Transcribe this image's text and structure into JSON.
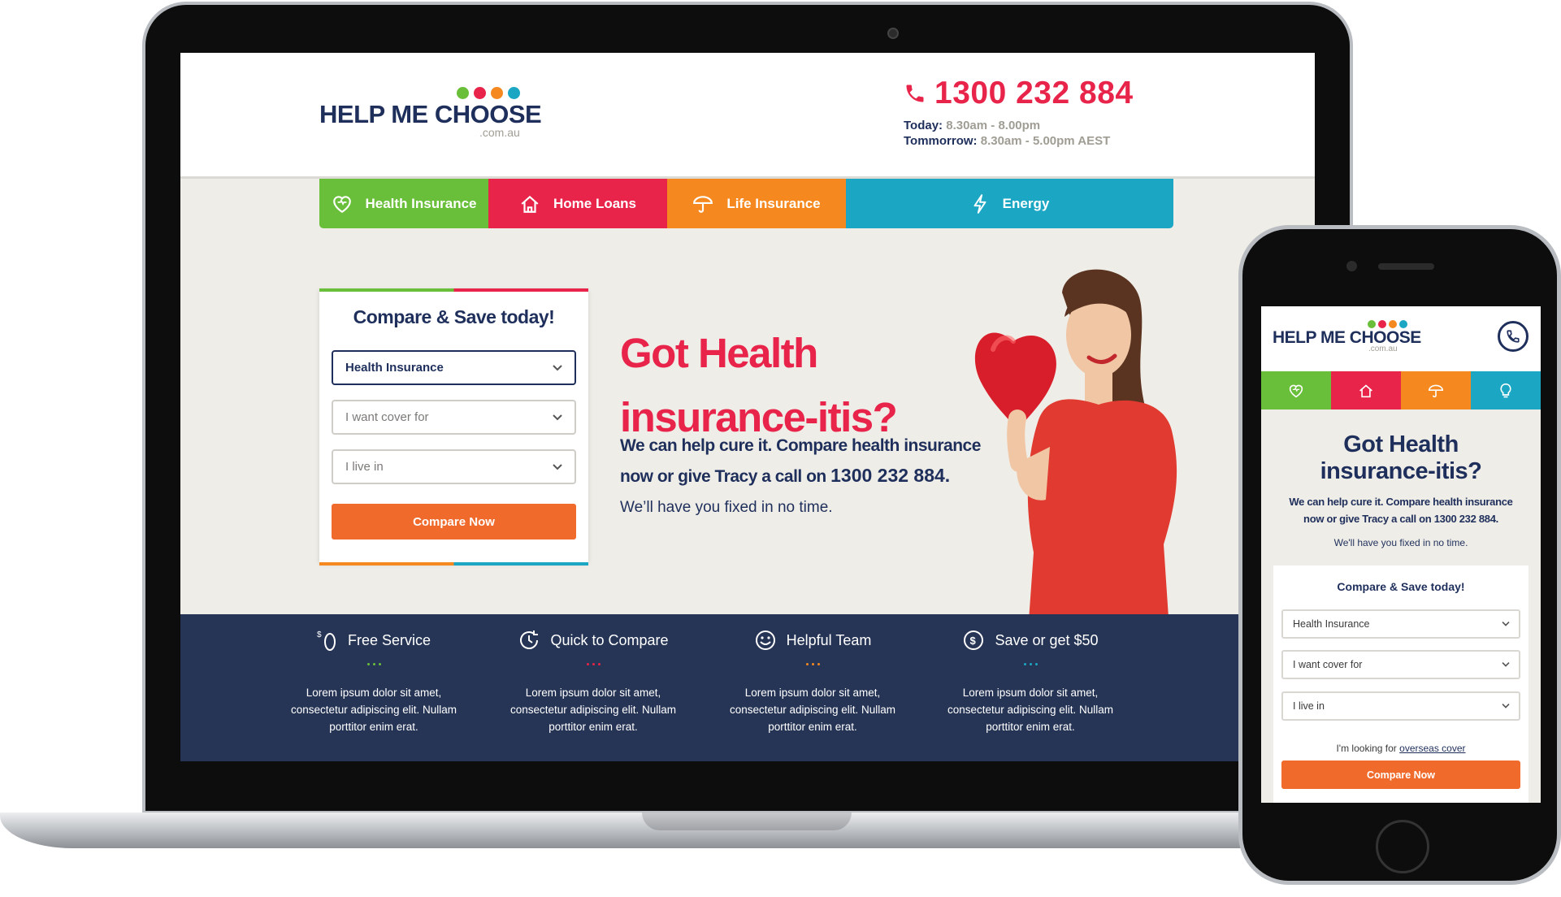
{
  "brand": {
    "name": "HELP ME CHOOSE",
    "domain": ".com.au",
    "dot_colors": [
      "#6abf3a",
      "#e8244a",
      "#f5891f",
      "#1ba7c4"
    ]
  },
  "header": {
    "phone": "1300 232 884",
    "today_label": "Today:",
    "today_hours": "8.30am - 8.00pm",
    "tomorrow_label": "Tommorrow:",
    "tomorrow_hours": "8.30am - 5.00pm AEST"
  },
  "nav": [
    {
      "label": "Health Insurance",
      "icon": "heart-icon",
      "color": "#6abf3a"
    },
    {
      "label": "Home Loans",
      "icon": "home-icon",
      "color": "#e8244a"
    },
    {
      "label": "Life Insurance",
      "icon": "umbrella-icon",
      "color": "#f5891f"
    },
    {
      "label": "Energy",
      "icon": "lightning-icon",
      "color": "#1ba7c4"
    }
  ],
  "form": {
    "title": "Compare & Save today!",
    "insurance_type": "Health Insurance",
    "cover_placeholder": "I want cover for",
    "location_placeholder": "I live in",
    "submit": "Compare Now"
  },
  "hero": {
    "line1": "Got Health",
    "line2": "insurance-itis?",
    "sub_line1": "We can help cure it. Compare health insurance",
    "sub_line2": "now or give Tracy a call on",
    "phone": "1300 232 884.",
    "small": "We’ll have you fixed in no time."
  },
  "features": [
    {
      "title": "Free Service",
      "icon": "dollar-zero-icon",
      "text": "Lorem ipsum dolor sit amet, consectetur adipiscing elit. Nullam porttitor enim erat.",
      "dot_color": "#6abf3a"
    },
    {
      "title": "Quick to Compare",
      "icon": "clock-refresh-icon",
      "text": "Lorem ipsum dolor sit amet, consectetur adipiscing elit. Nullam porttitor enim erat.",
      "dot_color": "#e8244a"
    },
    {
      "title": "Helpful Team",
      "icon": "smiley-icon",
      "text": "Lorem ipsum dolor sit amet, consectetur adipiscing elit. Nullam porttitor enim erat.",
      "dot_color": "#f5891f"
    },
    {
      "title": "Save or get $50",
      "icon": "dollar-circle-icon",
      "text": "Lorem ipsum dolor sit amet, consectetur adipiscing elit. Nullam porttitor enim erat.",
      "dot_color": "#1ba7c4"
    }
  ],
  "mobile": {
    "headline_line1": "Got Health",
    "headline_line2": "insurance-itis?",
    "sub_line1": "We can help cure it. Compare health insurance",
    "sub_line2": "now or give Tracy a call on 1300 232 884.",
    "small": "We'll have you fixed in no time.",
    "form_title": "Compare & Save today!",
    "insurance_type": "Health Insurance",
    "cover_placeholder": "I want cover for",
    "location_placeholder": "I live in",
    "overseas_prefix": "I'm looking for",
    "overseas_link": "overseas cover",
    "submit": "Compare Now"
  }
}
